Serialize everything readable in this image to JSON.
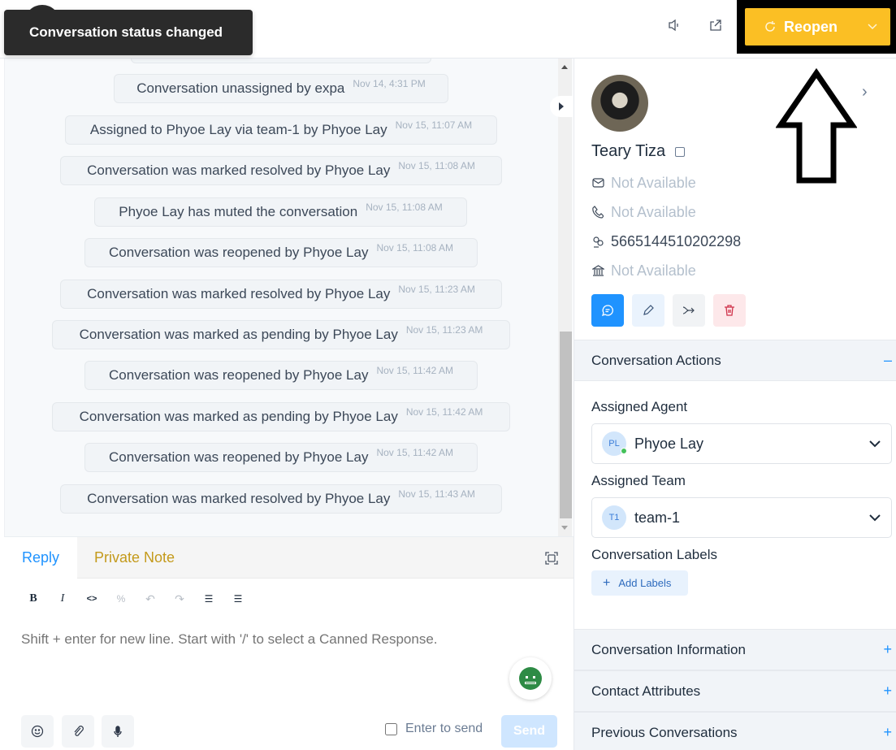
{
  "toast": {
    "message": "Conversation status changed"
  },
  "header": {
    "mute_icon": "speaker-icon",
    "share_icon": "share-icon",
    "primary_action": {
      "label": "Reopen",
      "icon": "reopen-icon",
      "color": "#fbbf24"
    }
  },
  "messages": [
    {
      "text": "Conversation unassigned by expa",
      "time": "Nov 14, 4:31 PM"
    },
    {
      "text": "Assigned to Phyoe Lay via team-1 by Phyoe Lay",
      "time": "Nov 15, 11:07 AM"
    },
    {
      "text": "Conversation was marked resolved by Phyoe Lay",
      "time": "Nov 15, 11:08 AM"
    },
    {
      "text": "Phyoe Lay has muted the conversation",
      "time": "Nov 15, 11:08 AM"
    },
    {
      "text": "Conversation was reopened by Phyoe Lay",
      "time": "Nov 15, 11:08 AM"
    },
    {
      "text": "Conversation was marked resolved by Phyoe Lay",
      "time": "Nov 15, 11:23 AM"
    },
    {
      "text": "Conversation was marked as pending by Phyoe Lay",
      "time": "Nov 15, 11:23 AM"
    },
    {
      "text": "Conversation was reopened by Phyoe Lay",
      "time": "Nov 15, 11:42 AM"
    },
    {
      "text": "Conversation was marked as pending by Phyoe Lay",
      "time": "Nov 15, 11:42 AM"
    },
    {
      "text": "Conversation was reopened by Phyoe Lay",
      "time": "Nov 15, 11:42 AM"
    },
    {
      "text": "Conversation was marked resolved by Phyoe Lay",
      "time": "Nov 15, 11:43 AM"
    }
  ],
  "reply": {
    "tabs": {
      "reply": "Reply",
      "private_note": "Private Note"
    },
    "toolbar": {
      "bold": "B",
      "italic": "I",
      "code": "<>",
      "link": "%",
      "undo": "↶",
      "redo": "↷",
      "bullet_list": "☰",
      "ordered_list": "☰"
    },
    "placeholder": "Shift + enter for new line. Start with '/' to select a Canned Response.",
    "enter_to_send": "Enter to send",
    "send": "Send"
  },
  "contact": {
    "name": "Teary Tiza",
    "email": "Not Available",
    "phone": "Not Available",
    "identifier": "5665144510202298",
    "company": "Not Available"
  },
  "sidebar": {
    "sections": {
      "actions": "Conversation Actions",
      "info": "Conversation Information",
      "attributes": "Contact Attributes",
      "previous": "Previous Conversations"
    },
    "assigned_agent_label": "Assigned Agent",
    "assigned_agent": {
      "initials": "PL",
      "name": "Phyoe Lay"
    },
    "assigned_team_label": "Assigned Team",
    "assigned_team": {
      "initials": "T1",
      "name": "team-1"
    },
    "labels_label": "Conversation Labels",
    "add_labels": "Add Labels"
  }
}
